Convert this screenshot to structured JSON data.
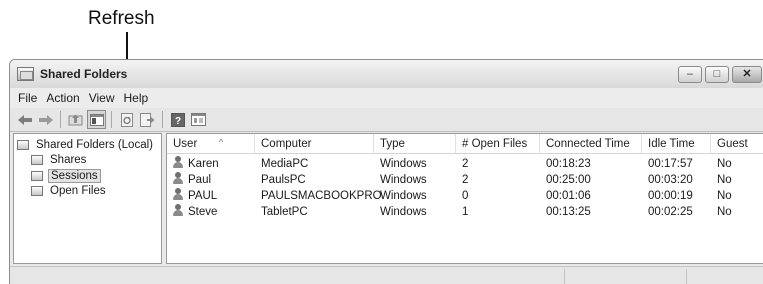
{
  "annotation": {
    "label": "Refresh"
  },
  "window": {
    "title": "Shared Folders",
    "controls": {
      "minimize": "–",
      "maximize": "□",
      "close": "✕"
    }
  },
  "menu": [
    "File",
    "Action",
    "View",
    "Help"
  ],
  "toolbar": {
    "icons": [
      "back-arrow-icon",
      "forward-arrow-icon",
      "up-folder-icon",
      "show-hide-tree-icon",
      "refresh-icon",
      "export-list-icon",
      "help-icon",
      "properties-icon"
    ]
  },
  "tree": {
    "root": "Shared Folders (Local)",
    "children": [
      "Shares",
      "Sessions",
      "Open Files"
    ],
    "selected": "Sessions"
  },
  "table": {
    "columns": [
      "User",
      "Computer",
      "Type",
      "# Open Files",
      "Connected Time",
      "Idle Time",
      "Guest"
    ],
    "rows": [
      [
        "Karen",
        "MediaPC",
        "Windows",
        "2",
        "00:18:23",
        "00:17:57",
        "No"
      ],
      [
        "Paul",
        "PaulsPC",
        "Windows",
        "2",
        "00:25:00",
        "00:03:20",
        "No"
      ],
      [
        "PAUL",
        "PAULSMACBOOKPRO",
        "Windows",
        "0",
        "00:01:06",
        "00:00:19",
        "No"
      ],
      [
        "Steve",
        "TabletPC",
        "Windows",
        "1",
        "00:13:25",
        "00:02:25",
        "No"
      ]
    ]
  }
}
